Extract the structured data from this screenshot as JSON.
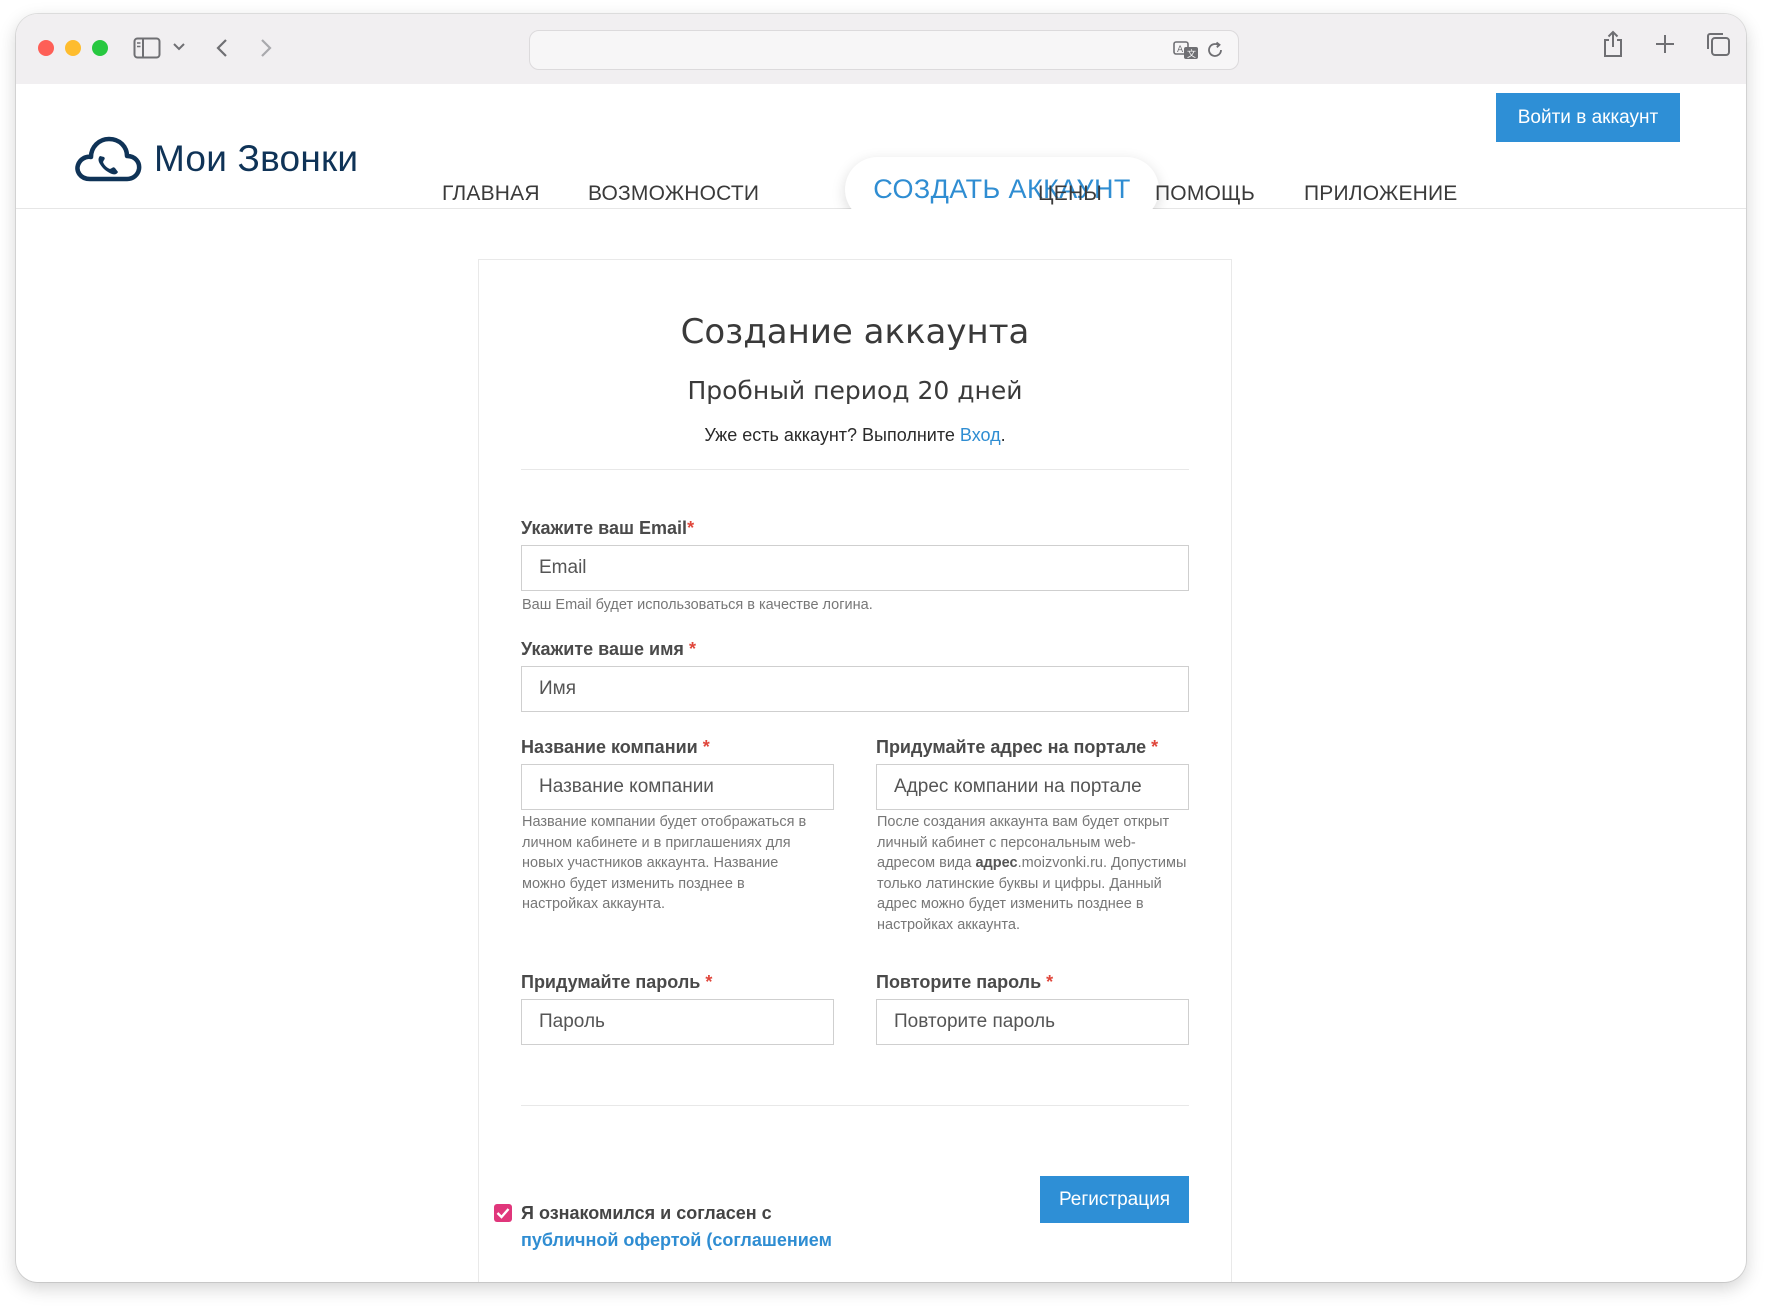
{
  "colors": {
    "accent": "#2e8fd6",
    "link": "#2f8dd2",
    "required": "#e0463b",
    "checkbox": "#e0367b",
    "logo": "#0f3357"
  },
  "site": {
    "logo_text": "Мои Звонки",
    "login_button": "Войти в аккаунт",
    "nav": {
      "home": "ГЛАВНАЯ",
      "features": "ВОЗМОЖНОСТИ",
      "create": "СОЗДАТЬ АККАУНТ",
      "prices": "ЦЕНЫ",
      "help": "ПОМОЩЬ",
      "app": "ПРИЛОЖЕНИЕ"
    }
  },
  "form": {
    "title": "Создание аккаунта",
    "subtitle": "Пробный период 20 дней",
    "has_account": "Уже есть аккаунт? Выполните ",
    "login_link": "Вход",
    "login_dot": ".",
    "required_mark": "*",
    "email": {
      "label": "Укажите ваш Email",
      "placeholder": "Email",
      "hint": "Ваш Email будет использоваться в качестве логина."
    },
    "name": {
      "label": "Укажите ваше имя ",
      "placeholder": "Имя"
    },
    "company": {
      "label": "Название компании ",
      "placeholder": "Название компании",
      "hint": "Название компании будет отображаться в личном кабинете и в приглашениях для новых участников аккаунта. Название можно будет изменить позднее в настройках аккаунта."
    },
    "portal": {
      "label": "Придумайте адрес на портале ",
      "placeholder": "Адрес компании на портале",
      "hint_before": "После создания аккаунта вам будет открыт личный кабинет с персональным web-адресом вида ",
      "hint_bold": "адрес",
      "hint_after": ".moizvonki.ru. Допустимы только латинские буквы и цифры. Данный адрес можно будет изменить позднее в настройках аккаунта."
    },
    "password": {
      "label": "Придумайте пароль ",
      "placeholder": "Пароль"
    },
    "password_repeat": {
      "label": "Повторите пароль ",
      "placeholder": "Повторите пароль"
    },
    "agree_text": "Я ознакомился и согласен с",
    "agree_link": "публичной офертой (соглашением",
    "agree_checked": true,
    "register_button": "Регистрация"
  }
}
